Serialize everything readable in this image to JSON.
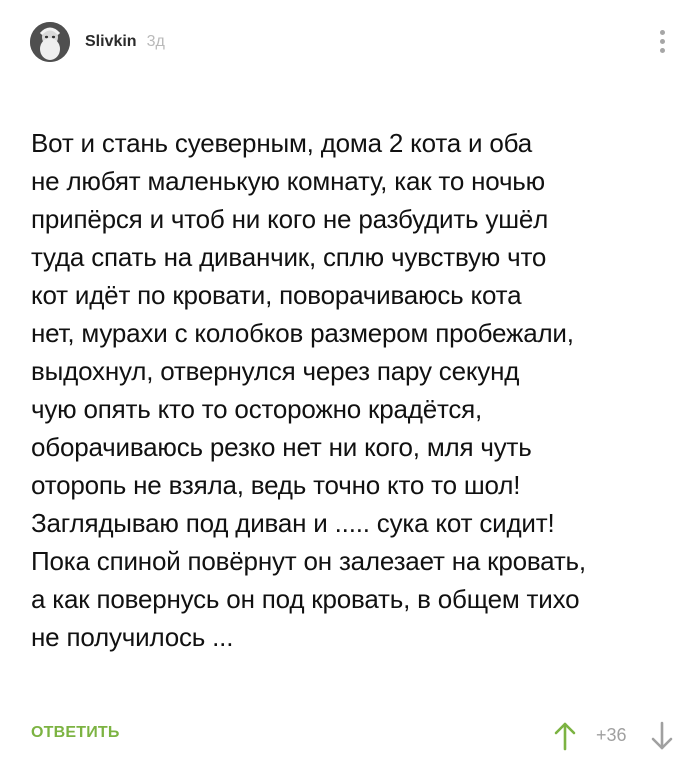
{
  "comment": {
    "author": "Slivkin",
    "time_ago": "3д",
    "text_lines": [
      "Вот и стань суеверным, дома 2 кота и оба",
      "не любят маленькую комнату, как то ночью",
      "припёрся и чтоб ни кого не разбудить ушёл",
      "туда спать на диванчик, сплю чувствую что",
      "кот идёт по кровати, поворачиваюсь кота",
      "нет, мурахи с колобков размером пробежали,",
      "выдохнул, отвернулся через пару секунд",
      "чую опять кто то осторожно крадётся,",
      "оборачиваюсь резко нет ни кого, мля чуть",
      "оторопь не взяла, ведь точно кто то шол!",
      "Заглядываю под диван и ..... сука кот сидит!",
      "Пока спиной повёрнут он залезает на кровать,",
      "а как повернусь он под кровать, в общем тихо",
      "не получилось ..."
    ],
    "reply_label": "ОТВЕТИТЬ",
    "rating": "+36"
  },
  "icons": {
    "avatar": "avatar",
    "more": "more-vertical-icon",
    "vote_up": "arrow-up-icon",
    "vote_down": "arrow-down-icon"
  },
  "colors": {
    "reply": "#7cb342",
    "vote_up": "#7cb342",
    "muted": "#a0a0a0",
    "text": "#111111"
  }
}
